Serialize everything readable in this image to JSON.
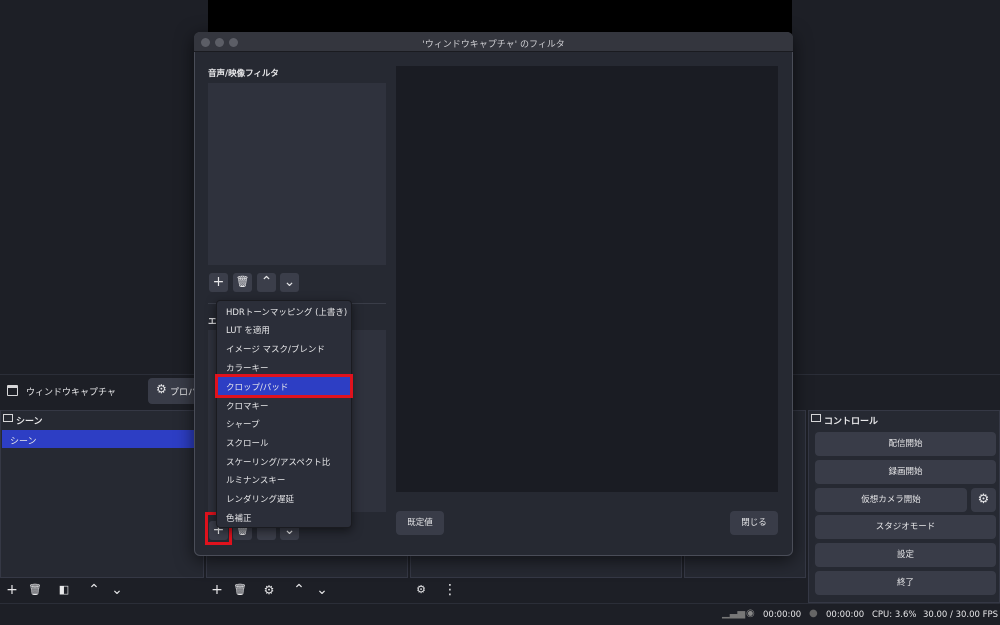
{
  "source_bar": {
    "source_name": "ウィンドウキャプチャ",
    "properties_label": "プロパ"
  },
  "scenes_dock": {
    "header": "シーン",
    "items": [
      "シーン"
    ]
  },
  "controls_dock": {
    "header": "コントロール",
    "buttons": [
      "配信開始",
      "録画開始",
      "仮想カメラ開始",
      "スタジオモード",
      "設定",
      "終了"
    ]
  },
  "status_bar": {
    "stream_time": "00:00:00",
    "record_time": "00:00:00",
    "cpu": "CPU: 3.6%",
    "fps": "30.00 / 30.00 FPS"
  },
  "dialog": {
    "title": "'ウィンドウキャプチャ' のフィルタ",
    "av_filters_label": "音声/映像フィルタ",
    "effect_filters_label": "エ",
    "defaults_button": "既定値",
    "close_button": "閉じる"
  },
  "filter_menu": {
    "items": [
      "HDRトーンマッピング (上書き)",
      "LUT を適用",
      "イメージ マスク/ブレンド",
      "カラーキー",
      "クロップ/パッド",
      "クロマキー",
      "シャープ",
      "スクロール",
      "スケーリング/アスペクト比",
      "ルミナンスキー",
      "レンダリング遅延",
      "色補正"
    ],
    "selected": "クロップ/パッド"
  },
  "colors": {
    "accent": "#2d3ec4",
    "highlight_box": "#e0121d"
  }
}
